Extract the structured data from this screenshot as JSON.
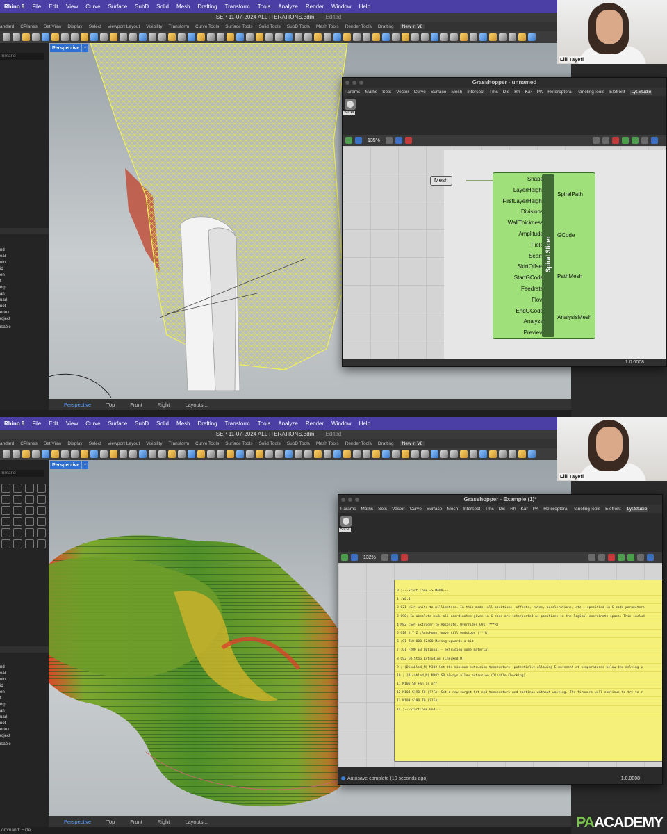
{
  "menubar": {
    "app": "Rhino 8",
    "items": [
      "File",
      "Edit",
      "View",
      "Curve",
      "Surface",
      "SubD",
      "Solid",
      "Mesh",
      "Drafting",
      "Transform",
      "Tools",
      "Analyze",
      "Render",
      "Window",
      "Help"
    ]
  },
  "document": {
    "title": "SEP 11-07-2024 ALL ITERATIONS.3dm",
    "status": "— Edited"
  },
  "toolbar_tabs": [
    "andard",
    "CPlanes",
    "Set View",
    "Display",
    "Select",
    "Viewport Layout",
    "Visibility",
    "Transform",
    "Curve Tools",
    "Surface Tools",
    "Solid Tools",
    "SubD Tools",
    "Mesh Tools",
    "Render Tools",
    "Drafting",
    "New in V8"
  ],
  "command_prompt": "mmand",
  "osnaps": [
    "nd",
    "ear",
    "oint",
    "id",
    "en",
    "t",
    "erp",
    "an",
    "uad",
    "not",
    "ertex",
    "roject"
  ],
  "osnap_disable": "isable",
  "viewport": {
    "name": "Perspective",
    "dropdown": "▾"
  },
  "viewport_tabs": [
    "Perspective",
    "Top",
    "Front",
    "Right",
    "Layouts..."
  ],
  "webcam": {
    "name": "Lili Tayefi"
  },
  "grasshopper_tabs": [
    "Params",
    "Maths",
    "Sets",
    "Vector",
    "Curve",
    "Surface",
    "Mesh",
    "Intersect",
    "Tms",
    "Dis",
    "Rh",
    "Ka²",
    "PK",
    "Heteroptera",
    "PanelingTools",
    "Elefront",
    "Lyt.Studio"
  ],
  "slicer_label": "Slicer",
  "top": {
    "gh_title": "Grasshopper - unnamed",
    "zoom": "135%",
    "mesh_param": "Mesh",
    "component": {
      "name": "Spiral Slicer",
      "inputs": [
        "Shape",
        "LayerHeight",
        "FirstLayerHeight",
        "Divisions",
        "WallThickness",
        "Amplitude",
        "Field",
        "Seam",
        "SkirtOffset",
        "StartGCode",
        "Feedrate",
        "Flow",
        "EndGCode",
        "Analyze",
        "Preview"
      ],
      "outputs": [
        "SpiralPath",
        "GCode",
        "PathMesh",
        "AnalysisMesh"
      ]
    },
    "version": "1.0.0008",
    "status_left": ""
  },
  "bottom": {
    "gh_title": "Grasshopper - Example (1)*",
    "zoom": "132%",
    "gcode_lines": [
      "0 ;---Start Code => MADP---",
      "1 ;V0.4",
      "2 G21 ;Set units to millimeters. In this mode, all positions, offsets, rates, accelerations, etc., specified in G-code parameters",
      "3 G90; In absolute mode all coordinates given in G-code are interpreted as positions in the logical coordinate space. This includ",
      "4 M82 ;Set Extruder to Absolute, Overrides G91 (***R)",
      "5 G28 X Y Z ;AutoHome, move till endstops (***R)",
      "6 ;G1 Z10.000 F2400 Moving upwards a bit",
      "7 ;G1 F200 E3  Optional - extruding some material",
      "8 G92 E0 Stop Extruding (Checked_M)",
      "9 ; (Disabled_M) M302  Set the minimum extrusion temperature, potentially allowing E movement at temperatures below the melting p",
      "10 ; (Disabled_M) M302 S0 always allow extrusion (Disable Checking)",
      "11 M106 S0  Fan is off",
      "12 M104 S190 T0  (??FA) Set a new target hot end temperature and continue without waiting. The firmware will continue to try to r",
      "13 M109 S190 T0  (??FA)",
      "14 ;---StartCode End---"
    ],
    "version": "1.0.0008",
    "status_left": "Autosave complete (10 seconds ago)"
  },
  "statusbar_bottom": "ommand: Hide",
  "brand": {
    "pa": "PA",
    "academy": "ACADEMY"
  },
  "colors": {
    "menubar": "#4b3fa6",
    "viewport_label": "#2f6fcf",
    "component": "#9fe07b",
    "panel": "#f5f07a",
    "brand_accent": "#79c251"
  }
}
